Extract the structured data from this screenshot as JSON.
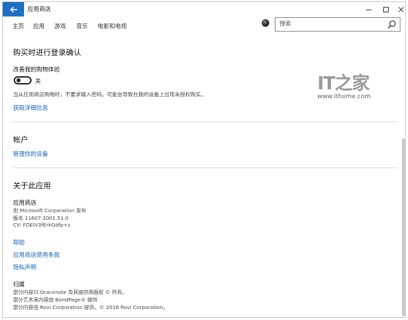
{
  "window": {
    "title": "应用商店",
    "controls": {
      "minimize": "minimize-icon",
      "maximize": "maximize-icon",
      "close": "close-icon"
    }
  },
  "nav": {
    "items": [
      {
        "label": "主页"
      },
      {
        "label": "应用"
      },
      {
        "label": "游戏"
      },
      {
        "label": "音乐"
      },
      {
        "label": "电影和电视"
      }
    ]
  },
  "search": {
    "placeholder": "搜索"
  },
  "purchase_section": {
    "heading": "购买时进行登录确认",
    "setting_label": "改善我的购物体验",
    "toggle_state": "关",
    "description": "当从应用商店购物时，不要求输入密码。可能会导致在我的设备上出现未授权购买。",
    "link": "获取详细信息"
  },
  "account_section": {
    "heading": "帐户",
    "link": "管理你的设备"
  },
  "about_section": {
    "heading": "关于此应用",
    "app_name": "应用商店",
    "publisher": "由 Microsoft Corporation 发布",
    "version": "版本 11607.1001.51.0",
    "cv": "CV: FDEIV3fErkGdfp+z",
    "links": [
      {
        "label": "帮助"
      },
      {
        "label": "应用商店使用条款"
      },
      {
        "label": "隐私声明"
      }
    ],
    "attribution_heading": "归属",
    "attribution_lines": [
      "部分内容归 Gracenote 及其提供商版权 © 所有。",
      "部分艺术来内容由 BandPage® 提供",
      "部分内容由 Rovi Corporation 提供。© 2016 Rovi Corporation。"
    ]
  },
  "watermark": {
    "logo": "IT之家",
    "url": "www.ithome.com"
  },
  "colors": {
    "accent": "#1e6fc2",
    "link": "#1565b8"
  }
}
